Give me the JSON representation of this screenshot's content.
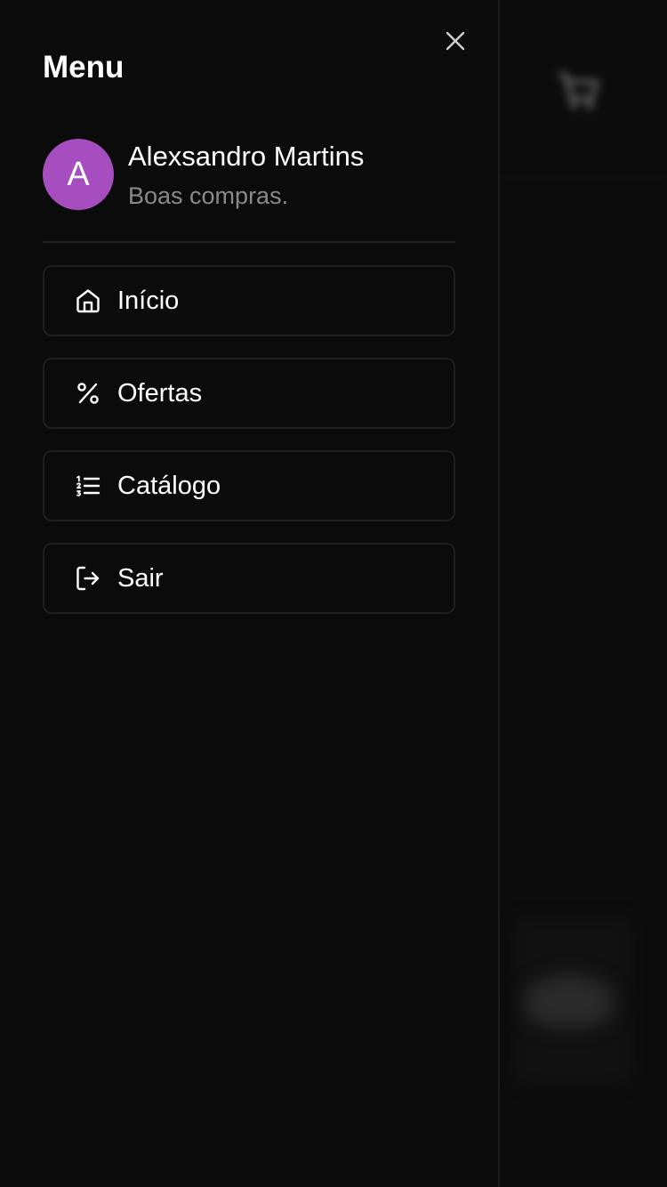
{
  "drawer": {
    "title": "Menu",
    "close_icon": "close-icon"
  },
  "profile": {
    "avatar_initial": "A",
    "avatar_color": "#a64ec0",
    "name": "Alexsandro Martins",
    "subtitle": "Boas compras."
  },
  "menu": {
    "items": [
      {
        "label": "Início",
        "icon": "home-icon"
      },
      {
        "label": "Ofertas",
        "icon": "percent-icon"
      },
      {
        "label": "Catálogo",
        "icon": "list-icon"
      },
      {
        "label": "Sair",
        "icon": "logout-icon"
      }
    ]
  },
  "background_app": {
    "cart_icon": "cart-icon"
  }
}
